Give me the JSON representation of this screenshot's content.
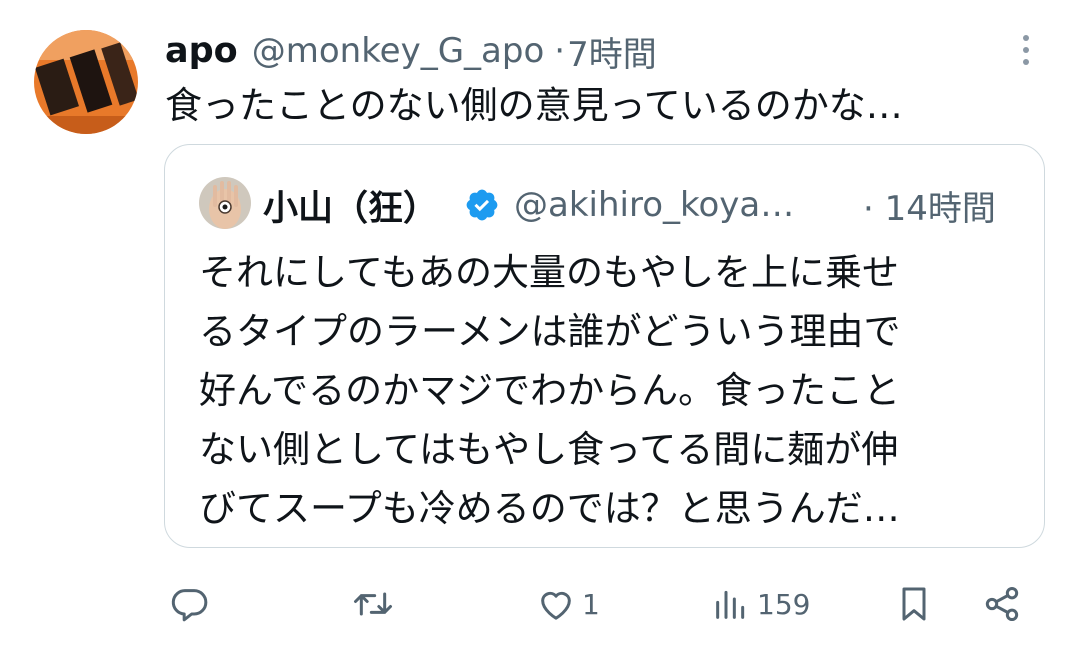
{
  "tweet": {
    "author_name": "apo",
    "author_handle": "@monkey_G_apo",
    "separator": "·",
    "time": "7時間",
    "text": "食ったことのない側の意見っているのかな…"
  },
  "quoted": {
    "author_name": "小山（狂）",
    "author_handle": "@akihiro_koya…",
    "time": "· 14時間",
    "verified": true,
    "text_lines": [
      "それにしてもあの大量のもやしを上に乗せ",
      "るタイプのラーメンは誰がどういう理由で",
      "好んでるのかマジでわからん。食ったこと",
      "ない側としてはもやし食ってる間に麺が伸",
      "びてスープも冷めるのでは？と思うんだ…"
    ]
  },
  "actions": {
    "reply_count": "",
    "retweet_count": "",
    "like_count": "1",
    "views_count": "159"
  },
  "colors": {
    "text": "#0f1419",
    "secondary": "#536471",
    "verified": "#1d9bf0",
    "border": "#cfd9de"
  },
  "icons": [
    "more-vertical-icon",
    "verified-icon",
    "reply-icon",
    "retweet-icon",
    "like-icon",
    "views-icon",
    "bookmark-icon",
    "share-icon"
  ]
}
